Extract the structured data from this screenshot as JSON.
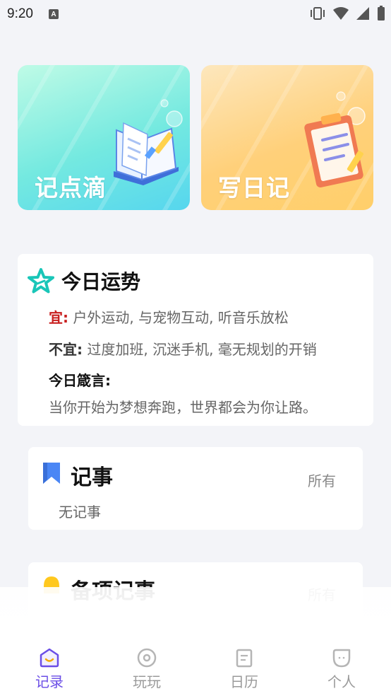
{
  "status": {
    "time": "9:20",
    "a_badge": "A"
  },
  "hero": {
    "left_label": "记点滴",
    "right_label": "写日记"
  },
  "fortune": {
    "title": "今日运势",
    "good_tag": "宜:",
    "good_text": " 户外运动, 与宠物互动, 听音乐放松",
    "bad_tag": "不宜:",
    "bad_text": " 过度加班, 沉迷手机, 毫无规划的开销",
    "motto_label": "今日箴言:",
    "motto_text": "当你开始为梦想奔跑，世界都会为你让路。"
  },
  "notes": {
    "title": "记事",
    "all_label": "所有",
    "empty_text": "无记事"
  },
  "backup": {
    "title": "备项记事",
    "all_label": "所有"
  },
  "tabs": [
    {
      "label": "记录",
      "icon": "home-icon",
      "active": true
    },
    {
      "label": "玩玩",
      "icon": "game-icon",
      "active": false
    },
    {
      "label": "日历",
      "icon": "calendar-icon",
      "active": false
    },
    {
      "label": "个人",
      "icon": "profile-icon",
      "active": false
    }
  ],
  "colors": {
    "accent": "#6a4de6",
    "good": "#c81e1e",
    "star": "#19c6b8",
    "bookmark": "#4a86f5"
  }
}
